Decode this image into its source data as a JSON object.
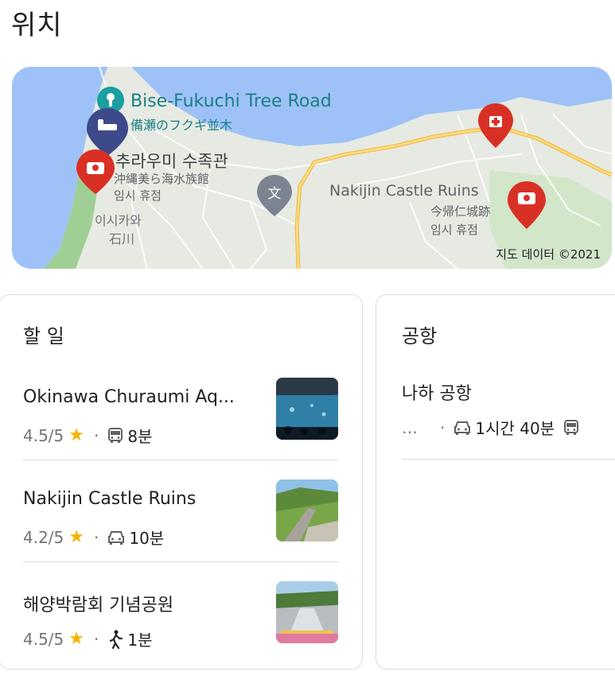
{
  "page": {
    "title": "위치"
  },
  "map": {
    "copyright": "지도 데이터 ©2021",
    "labels": {
      "tree_road": "Bise-Fukuchi Tree Road",
      "tree_road_jp": "備瀬のフクギ並木",
      "aquarium_ko": "추라우미 수족관",
      "aquarium_jp": "沖縄美ら海水族館",
      "aquarium_status": "임시 휴점",
      "ishikawa_ko": "이시카와",
      "ishikawa_jp": "石川",
      "castle": "Nakijin Castle Ruins",
      "castle_jp": "今帰仁城跡",
      "castle_status": "임시 휴점"
    }
  },
  "todo": {
    "heading": "할 일",
    "items": [
      {
        "name": "Okinawa Churaumi Aq...",
        "rating": "4.5/5",
        "time": "8분",
        "mode_icon": "bus-icon"
      },
      {
        "name": "Nakijin Castle Ruins",
        "rating": "4.2/5",
        "time": "10분",
        "mode_icon": "car-icon"
      },
      {
        "name": "해양박람회 기념공원",
        "rating": "4.5/5",
        "time": "1분",
        "mode_icon": "walk-icon"
      }
    ]
  },
  "airport": {
    "heading": "공항",
    "name": "나하 공항",
    "ellipsis": "…",
    "time": "1시간 40분"
  },
  "colors": {
    "star": "#f4b400",
    "pin_red": "#d93025",
    "sea": "#aecbfa",
    "land": "#e9ece6",
    "road": "#f6c34a"
  }
}
